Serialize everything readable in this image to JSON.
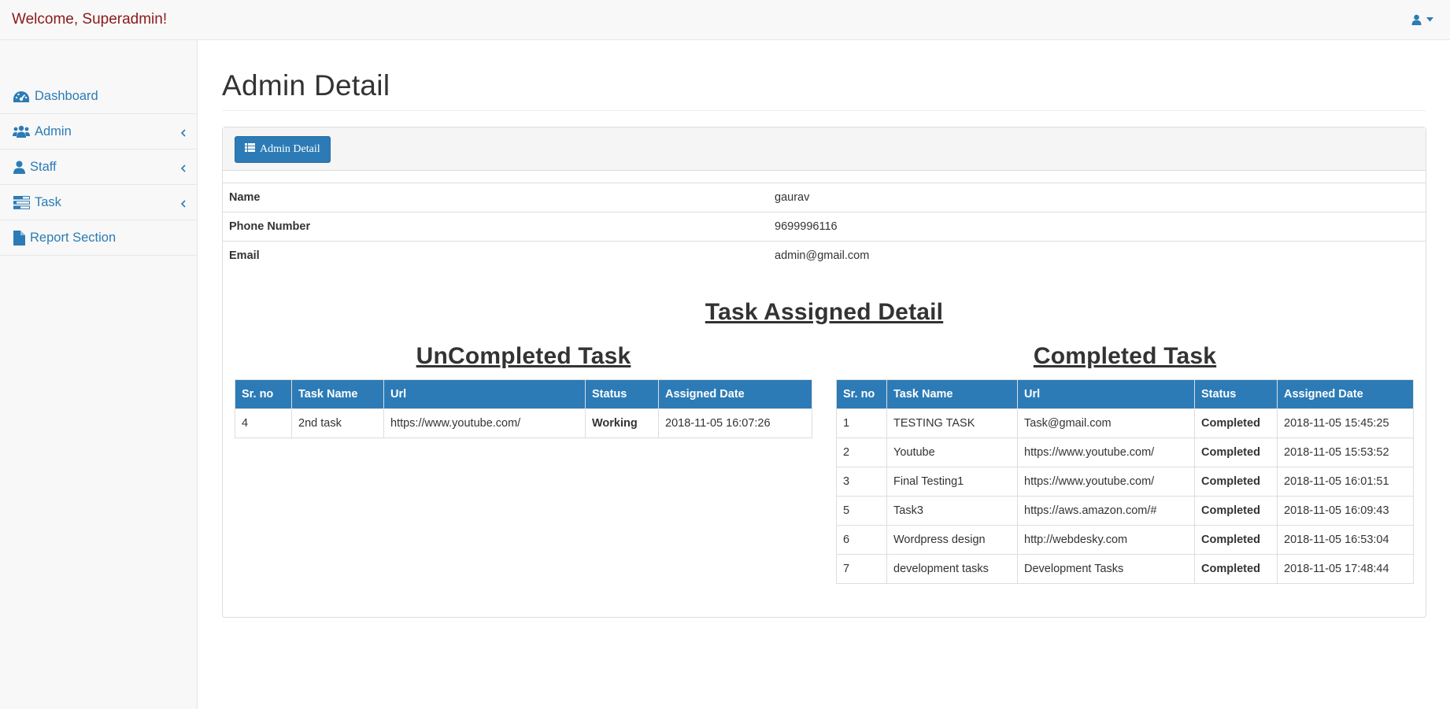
{
  "navbar": {
    "welcome": "Welcome, Superadmin!",
    "user_icon": "user-icon",
    "caret_icon": "caret-down-icon"
  },
  "sidebar": {
    "items": [
      {
        "label": "Dashboard",
        "icon": "dashboard-icon",
        "has_submenu": false
      },
      {
        "label": "Admin",
        "icon": "users-icon",
        "has_submenu": true
      },
      {
        "label": "Staff",
        "icon": "user-icon",
        "has_submenu": true
      },
      {
        "label": "Task",
        "icon": "tasks-icon",
        "has_submenu": true
      },
      {
        "label": "Report Section",
        "icon": "file-icon",
        "has_submenu": false
      }
    ]
  },
  "page": {
    "title": "Admin Detail",
    "detail_button": "Admin Detail"
  },
  "admin_info": {
    "rows": [
      {
        "key": "Name",
        "value": "gaurav"
      },
      {
        "key": "Phone Number",
        "value": "9699996116"
      },
      {
        "key": "Email",
        "value": "admin@gmail.com"
      }
    ]
  },
  "tasks": {
    "section_title": "Task Assigned Detail",
    "uncompleted": {
      "title": "UnCompleted Task",
      "headers": [
        "Sr. no",
        "Task Name",
        "Url",
        "Status",
        "Assigned Date"
      ],
      "rows": [
        [
          "4",
          "2nd task",
          "https://www.youtube.com/",
          "Working",
          "2018-11-05 16:07:26"
        ]
      ]
    },
    "completed": {
      "title": "Completed Task",
      "headers": [
        "Sr. no",
        "Task Name",
        "Url",
        "Status",
        "Assigned Date"
      ],
      "rows": [
        [
          "1",
          "TESTING TASK",
          "Task@gmail.com",
          "Completed",
          "2018-11-05 15:45:25"
        ],
        [
          "2",
          "Youtube",
          "https://www.youtube.com/",
          "Completed",
          "2018-11-05 15:53:52"
        ],
        [
          "3",
          "Final Testing1",
          "https://www.youtube.com/",
          "Completed",
          "2018-11-05 16:01:51"
        ],
        [
          "5",
          "Task3",
          "https://aws.amazon.com/#",
          "Completed",
          "2018-11-05 16:09:43"
        ],
        [
          "6",
          "Wordpress design",
          "http://webdesky.com",
          "Completed",
          "2018-11-05 16:53:04"
        ],
        [
          "7",
          "development tasks",
          "Development Tasks",
          "Completed",
          "2018-11-05 17:48:44"
        ]
      ]
    }
  },
  "colors": {
    "brand_text": "#8b1a1a",
    "link": "#2c7bb6",
    "table_header": "#2c7bb6"
  }
}
